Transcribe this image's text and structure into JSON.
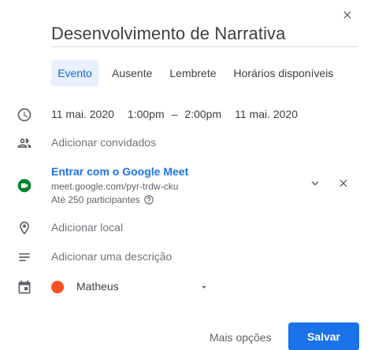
{
  "event": {
    "title": "Desenvolvimento de Narrativa"
  },
  "tabs": [
    {
      "label": "Evento",
      "active": true
    },
    {
      "label": "Ausente",
      "active": false
    },
    {
      "label": "Lembrete",
      "active": false
    },
    {
      "label": "Horários disponíveis",
      "active": false
    }
  ],
  "datetime": {
    "start_date": "11 mai. 2020",
    "start_time": "1:00pm",
    "separator": "–",
    "end_time": "2:00pm",
    "end_date": "11 mai. 2020"
  },
  "guests": {
    "placeholder": "Adicionar convidados"
  },
  "meet": {
    "title": "Entrar com o Google Meet",
    "link": "meet.google.com/pyr-trdw-cku",
    "participants": "Até 250 participantes"
  },
  "location": {
    "placeholder": "Adicionar local"
  },
  "description": {
    "placeholder": "Adicionar uma descrição"
  },
  "calendar": {
    "name": "Matheus",
    "color": "#f4511e"
  },
  "actions": {
    "more_label": "Mais opções",
    "save_label": "Salvar"
  },
  "colors": {
    "accent": "#1a73e8",
    "tab_active_bg": "#e8f0fe",
    "meet_green": "#00832d"
  },
  "icons": {
    "close": "close-icon",
    "clock": "clock-icon",
    "people": "people-icon",
    "meet": "google-meet-icon",
    "location": "location-pin-icon",
    "description": "notes-lines-icon",
    "calendar": "calendar-icon",
    "chevron": "chevron-down-icon",
    "help": "help-circle-icon",
    "dropdown": "dropdown-triangle-icon"
  }
}
